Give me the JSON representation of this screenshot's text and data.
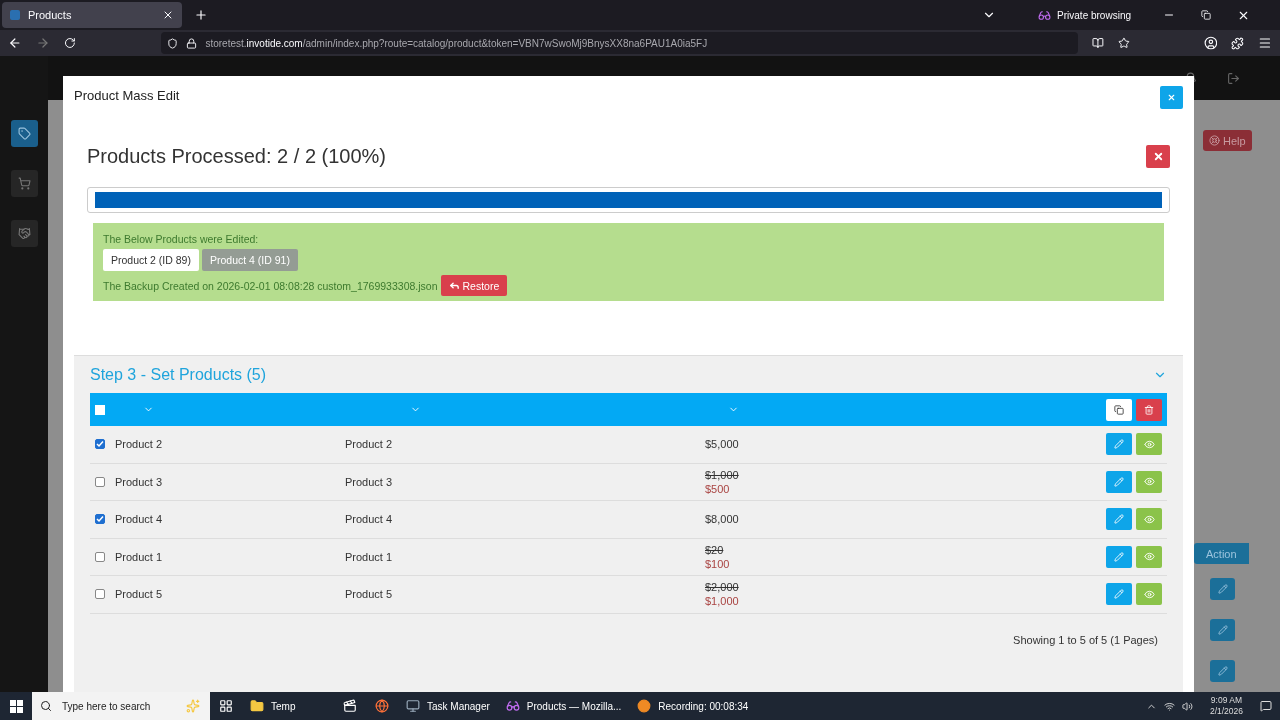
{
  "browser": {
    "tab_title": "Products",
    "private_label": "Private browsing",
    "url": "storetest.invotide.com/admin/index.php?route=catalog/product&token=VBN7wSwoMj9BnysXX8na6PAU1A0ia5FJ"
  },
  "sidebar": [
    {
      "selected": true
    },
    {
      "selected": false
    },
    {
      "selected": false
    }
  ],
  "background": {
    "help_button": "Help",
    "action_button": "Action"
  },
  "modal": {
    "title": "Product Mass Edit",
    "status": "Products Processed: 2 / 2 (100%)",
    "progress": {
      "level": 1
    },
    "result": {
      "heading": "The Below Products were Edited:",
      "products": [
        {
          "label": "Product 2 (ID 89)",
          "selected": true
        },
        {
          "label": "Product 4 (ID 91)",
          "selected": false
        }
      ],
      "backup": "The Backup Created on 2026-02-01 08:08:28 custom_1769933308.json",
      "restore_button": "Restore"
    },
    "section": {
      "title": "Step 3 - Set Products (5)",
      "expanded": true,
      "select_all": false,
      "rows": [
        {
          "checked": true,
          "name": "Product 2",
          "model": "Product 2",
          "price": "$5,000"
        },
        {
          "checked": false,
          "name": "Product 3",
          "model": "Product 3",
          "old_price": "$1,000",
          "price": "$500"
        },
        {
          "checked": true,
          "name": "Product 4",
          "model": "Product 4",
          "price": "$8,000"
        },
        {
          "checked": false,
          "name": "Product 1",
          "model": "Product 1",
          "old_price": "$20",
          "price": "$100"
        },
        {
          "checked": false,
          "name": "Product 5",
          "model": "Product 5",
          "old_price": "$2,000",
          "price": "$1,000"
        }
      ],
      "footer": "Showing 1 to 5 of 5 (1 Pages)"
    }
  },
  "taskbar": {
    "search_placeholder": "Type here to search",
    "apps": [
      {
        "kind": "taskview"
      },
      {
        "kind": "folder",
        "label": "Temp"
      },
      {
        "kind": "clapper"
      },
      {
        "kind": "browser"
      },
      {
        "kind": "monitor",
        "label": "Task Manager"
      },
      {
        "kind": "private",
        "label": "Products — Mozilla..."
      },
      {
        "kind": "recorder",
        "label": "Recording:  00:08:34"
      }
    ],
    "time": "9:09 AM",
    "date": "2/1/2026"
  }
}
